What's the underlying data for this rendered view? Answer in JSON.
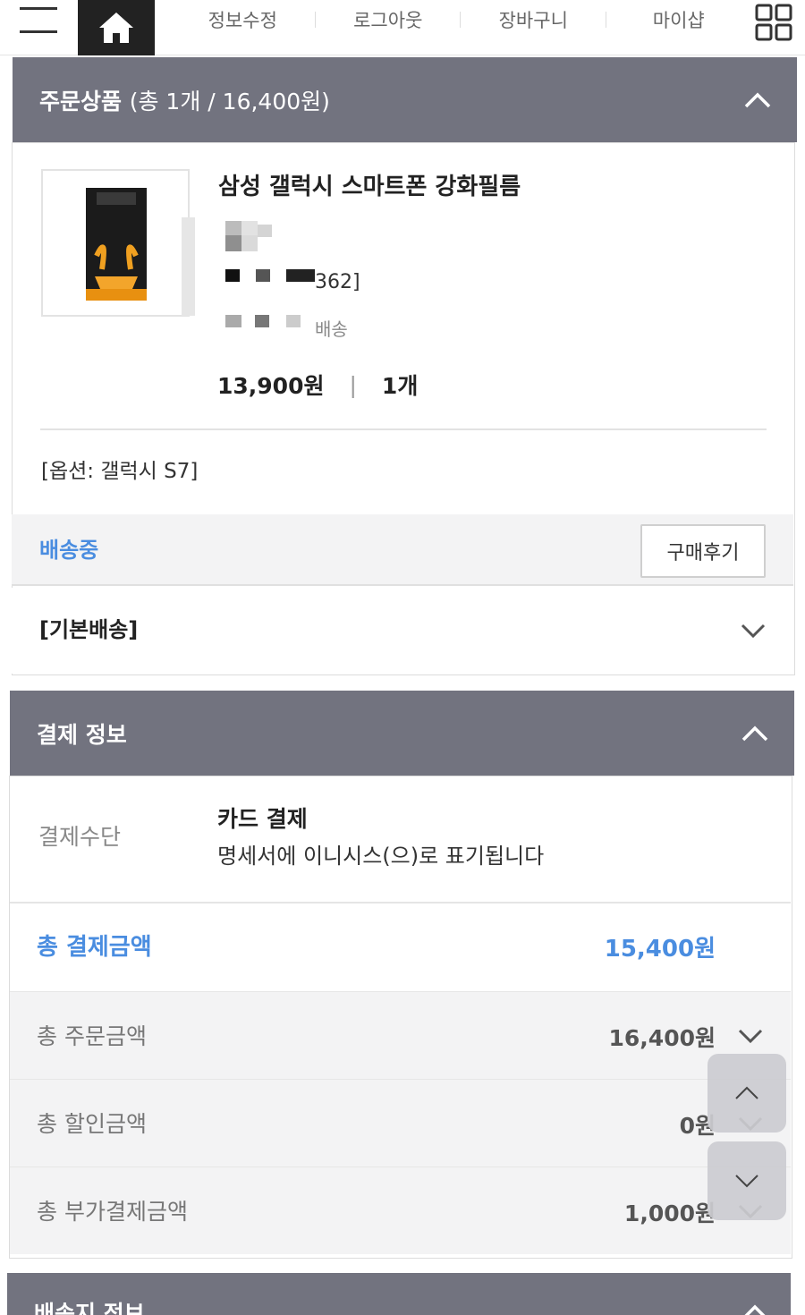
{
  "nav": {
    "links": [
      "정보수정",
      "로그아웃",
      "장바구니",
      "마이샵"
    ]
  },
  "order_section": {
    "title": "주문상품",
    "summary": "(총 1개 / 16,400원)"
  },
  "product": {
    "name": "삼성 갤럭시 스마트폰 강화필름",
    "partial_code": "362]",
    "partial_shipping": "배송",
    "price": "13,900원",
    "quantity": "1개",
    "option": "[옵션: 갤럭시 S7]",
    "status": "배송중",
    "review_button": "구매후기",
    "shipping_type": "[기본배송]"
  },
  "payment_section": {
    "title": "결제 정보",
    "method_label": "결제수단",
    "method_title": "카드 결제",
    "method_desc": "명세서에 이니시스(으)로 표기됩니다",
    "total_label": "총 결제금액",
    "total_value": "15,400원",
    "rows": [
      {
        "label": "총 주문금액",
        "value": "16,400원"
      },
      {
        "label": "총 할인금액",
        "value": "0원"
      },
      {
        "label": "총 부가결제금액",
        "value": "1,000원"
      }
    ]
  },
  "shipping_section": {
    "title": "배송지 정보"
  },
  "colors": {
    "header_bg": "#72737f",
    "accent_blue": "#4a8de0"
  },
  "icons": [
    "menu-icon",
    "home-icon",
    "grid-icon",
    "chevron-up-icon",
    "chevron-down-icon"
  ]
}
